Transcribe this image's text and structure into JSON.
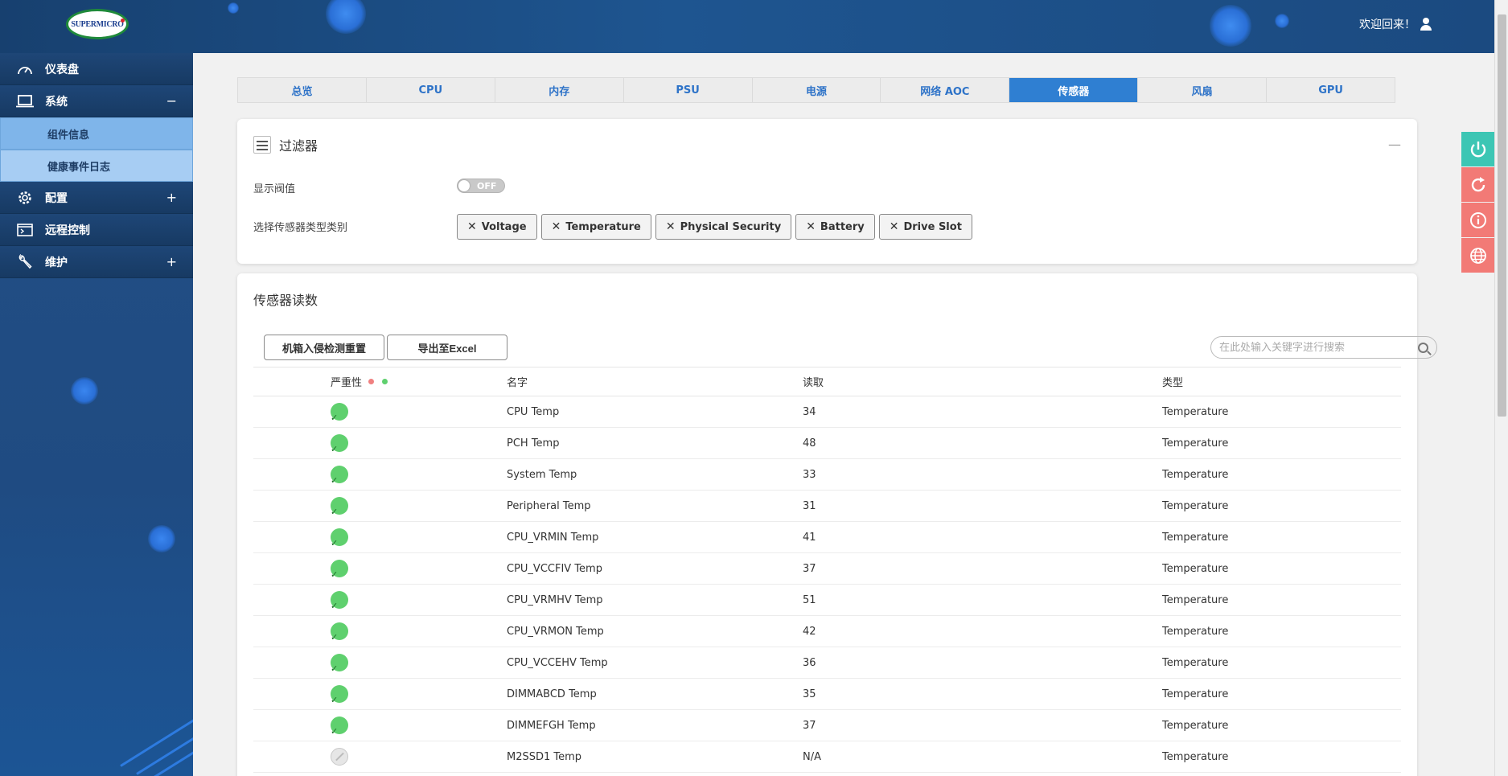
{
  "header": {
    "logo_text": "SUPERMICRO",
    "welcome": "欢迎回来！"
  },
  "sidebar": {
    "items": [
      {
        "label": "仪表盘",
        "icon": "gauge-icon",
        "toggle": ""
      },
      {
        "label": "系统",
        "icon": "laptop-icon",
        "toggle": "−"
      },
      {
        "label": "配置",
        "icon": "gear-icon",
        "toggle": "+"
      },
      {
        "label": "远程控制",
        "icon": "console-icon",
        "toggle": ""
      },
      {
        "label": "维护",
        "icon": "wrench-icon",
        "toggle": "+"
      }
    ],
    "sub_items": [
      {
        "label": "组件信息"
      },
      {
        "label": "健康事件日志"
      }
    ]
  },
  "tabs": [
    "总览",
    "CPU",
    "内存",
    "PSU",
    "电源",
    "网络 AOC",
    "传感器",
    "风扇",
    "GPU"
  ],
  "active_tab": "传感器",
  "filter": {
    "title": "过滤器",
    "collapse": "—",
    "threshold_label": "显示阀值",
    "switch_text": "OFF",
    "category_label": "选择传感器类型类别",
    "chips": [
      "Voltage",
      "Temperature",
      "Physical Security",
      "Battery",
      "Drive Slot"
    ]
  },
  "readings": {
    "title": "传感器读数",
    "reset_button": "机箱入侵检测重置",
    "export_button": "导出至Excel",
    "search_placeholder": "在此处输入关键字进行搜索",
    "columns": {
      "severity": "严重性",
      "name": "名字",
      "reading": "读取",
      "type": "类型"
    },
    "rows": [
      {
        "status": "ok",
        "name": "CPU Temp",
        "reading": "34",
        "type": "Temperature"
      },
      {
        "status": "ok",
        "name": "PCH Temp",
        "reading": "48",
        "type": "Temperature"
      },
      {
        "status": "ok",
        "name": "System Temp",
        "reading": "33",
        "type": "Temperature"
      },
      {
        "status": "ok",
        "name": "Peripheral Temp",
        "reading": "31",
        "type": "Temperature"
      },
      {
        "status": "ok",
        "name": "CPU_VRMIN Temp",
        "reading": "41",
        "type": "Temperature"
      },
      {
        "status": "ok",
        "name": "CPU_VCCFIV Temp",
        "reading": "37",
        "type": "Temperature"
      },
      {
        "status": "ok",
        "name": "CPU_VRMHV Temp",
        "reading": "51",
        "type": "Temperature"
      },
      {
        "status": "ok",
        "name": "CPU_VRMON Temp",
        "reading": "42",
        "type": "Temperature"
      },
      {
        "status": "ok",
        "name": "CPU_VCCEHV Temp",
        "reading": "36",
        "type": "Temperature"
      },
      {
        "status": "ok",
        "name": "DIMMABCD Temp",
        "reading": "35",
        "type": "Temperature"
      },
      {
        "status": "ok",
        "name": "DIMMEFGH Temp",
        "reading": "37",
        "type": "Temperature"
      },
      {
        "status": "na",
        "name": "M2SSD1 Temp",
        "reading": "N/A",
        "type": "Temperature"
      }
    ]
  },
  "colors": {
    "accent": "#2f7fd2",
    "ok": "#5fd06e",
    "critical_dot": "#f08080",
    "normal_dot": "#5fd06e",
    "power": "#3cc6b4",
    "action": "#f27a76"
  },
  "quick_actions": [
    "power-icon",
    "refresh-icon",
    "info-icon",
    "globe-icon"
  ]
}
